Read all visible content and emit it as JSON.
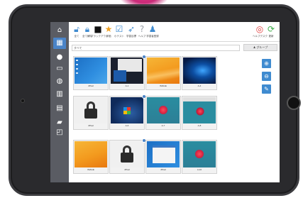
{
  "toolbar": {
    "items": [
      {
        "label": "全て",
        "icon": "lock-open-icon",
        "color": "#3f8bd0"
      },
      {
        "label": "全て解除",
        "icon": "lock-icon",
        "color": "#3f8bd0"
      },
      {
        "label": "ブラックアウト",
        "icon": "monitor-icon",
        "color": "#111111"
      },
      {
        "label": "評価",
        "icon": "star-icon",
        "color": "#f0a020"
      },
      {
        "label": "小テスト",
        "icon": "checklist-icon",
        "color": "#3f8bd0"
      },
      {
        "label": "学習目標",
        "icon": "rocket-icon",
        "color": "#3f8bd0"
      },
      {
        "label": "ヘルプ",
        "icon": "help-icon",
        "color": "#9aa0a8"
      },
      {
        "label": "学習者登録",
        "icon": "person-icon",
        "color": "#3f8bd0"
      }
    ],
    "right": [
      {
        "label": "ヘルプデスク",
        "icon": "lifebuoy-icon",
        "color": "#e23c3c"
      },
      {
        "label": "更新",
        "icon": "refresh-icon",
        "color": "#3fae4a"
      }
    ]
  },
  "search": {
    "value": "すべて"
  },
  "group_button": {
    "label": "グループ"
  },
  "sidebar": {
    "items": [
      {
        "icon": "home-icon"
      },
      {
        "icon": "grid-icon",
        "active": true
      },
      {
        "icon": "alert-icon"
      },
      {
        "icon": "window-icon"
      },
      {
        "icon": "globe-icon"
      },
      {
        "icon": "bar-chart-icon"
      },
      {
        "icon": "document-icon"
      },
      {
        "icon": "folder-icon"
      },
      {
        "icon": "layers-icon"
      }
    ]
  },
  "zoom": {
    "in": "zoom-in-icon",
    "out": "zoom-out-icon",
    "edit": "pen-icon"
  },
  "cards": [
    {
      "caption": "ZPad",
      "thumb": "t-win10blue",
      "badge": false
    },
    {
      "caption": "A-1",
      "thumb": "t-desktop-mixed",
      "badge": true
    },
    {
      "caption": "IMAGE",
      "thumb": "t-win8orange",
      "badge": false
    },
    {
      "caption": "A-4",
      "thumb": "t-win10hero",
      "badge": false
    },
    {
      "caption": "ZPad",
      "thumb": "t-lock",
      "badge": false
    },
    {
      "caption": "A-6",
      "thumb": "t-win7",
      "badge": true
    },
    {
      "caption": "A-7",
      "thumb": "t-flower",
      "badge": false
    },
    {
      "caption": "A-8",
      "thumb": "t-flower-desk",
      "badge": false
    },
    {
      "caption": "IMAGE",
      "thumb": "t-win8orange2",
      "badge": false
    },
    {
      "caption": "ZPad",
      "thumb": "t-lock",
      "badge": true
    },
    {
      "caption": "ZPad",
      "thumb": "t-winblue-window",
      "badge": false
    },
    {
      "caption": "A-10",
      "thumb": "t-flower",
      "badge": false
    }
  ]
}
